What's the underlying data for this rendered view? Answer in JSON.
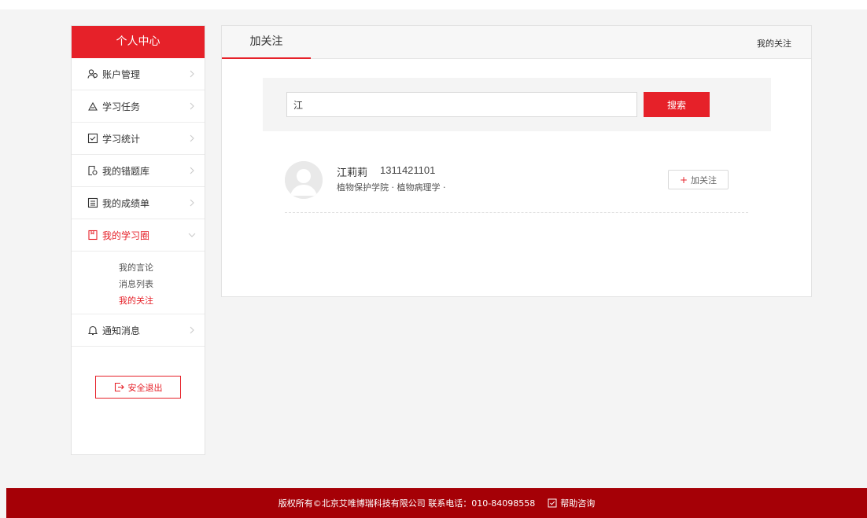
{
  "sidebar": {
    "title": "个人中心",
    "items": [
      {
        "label": "账户管理",
        "icon": "user-group-icon"
      },
      {
        "label": "学习任务",
        "icon": "task-icon"
      },
      {
        "label": "学习统计",
        "icon": "checkbox-icon"
      },
      {
        "label": "我的错题库",
        "icon": "document-search-icon"
      },
      {
        "label": "我的成绩单",
        "icon": "list-icon"
      },
      {
        "label": "我的学习圈",
        "icon": "bookmark-icon"
      },
      {
        "label": "通知消息",
        "icon": "bell-icon"
      }
    ],
    "sub_items": [
      {
        "label": "我的言论"
      },
      {
        "label": "消息列表"
      },
      {
        "label": "我的关注"
      }
    ],
    "logout_label": "安全退出"
  },
  "main": {
    "tab_label": "加关注",
    "header_link": "我的关注",
    "search": {
      "value": "江",
      "button_label": "搜索"
    },
    "results": [
      {
        "name": "江莉莉",
        "phone": "1311421101",
        "department": "植物保护学院 · 植物病理学 ·",
        "follow_label": "加关注"
      }
    ]
  },
  "footer": {
    "copyright": "版权所有©北京艾唯博瑞科技有限公司 联系电话：010-84098558",
    "help_label": "帮助咨询"
  },
  "colors": {
    "accent": "#e62129",
    "footer": "#a50006",
    "background": "#f4f4f4"
  }
}
